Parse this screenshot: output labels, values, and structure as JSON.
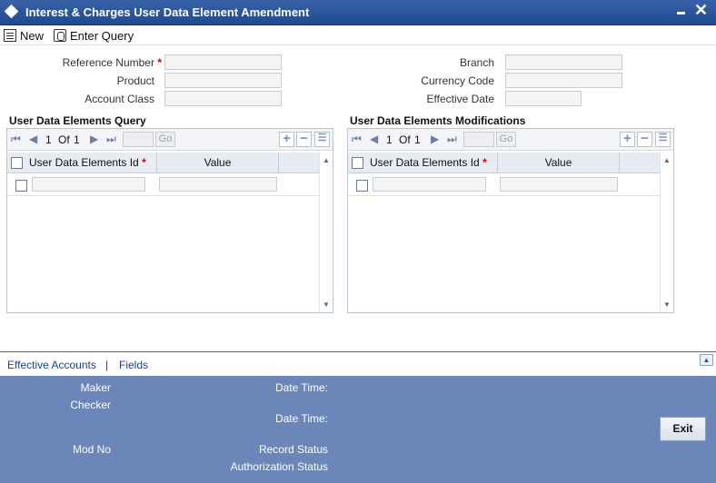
{
  "window": {
    "title": "Interest & Charges User Data Element Amendment"
  },
  "toolbar": {
    "new_label": "New",
    "enter_query_label": "Enter Query"
  },
  "form": {
    "reference_number": {
      "label": "Reference Number",
      "required": "*",
      "value": ""
    },
    "product": {
      "label": "Product",
      "value": ""
    },
    "account_class": {
      "label": "Account Class",
      "value": ""
    },
    "branch": {
      "label": "Branch",
      "value": ""
    },
    "currency_code": {
      "label": "Currency Code",
      "value": ""
    },
    "effective_date": {
      "label": "Effective Date",
      "value": ""
    }
  },
  "query_grid": {
    "title": "User Data Elements Query",
    "page_current": "1",
    "page_of": "Of",
    "page_total": "1",
    "go_label": "Go",
    "columns": {
      "id": "User Data Elements Id",
      "id_required": "*",
      "value": "Value"
    }
  },
  "mod_grid": {
    "title": "User Data Elements Modifications",
    "page_current": "1",
    "page_of": "Of",
    "page_total": "1",
    "go_label": "Go",
    "columns": {
      "id": "User Data Elements Id",
      "id_required": "*",
      "value": "Value"
    }
  },
  "links": {
    "effective_accounts": "Effective Accounts",
    "separator": "|",
    "fields": "Fields"
  },
  "footer": {
    "maker": "Maker",
    "checker": "Checker",
    "date_time_1": "Date Time:",
    "date_time_2": "Date Time:",
    "mod_no": "Mod No",
    "record_status": "Record Status",
    "authorization_status": "Authorization Status",
    "exit_label": "Exit"
  },
  "icons": {
    "titlebar": "diamond-icon",
    "new": "new-document-icon",
    "enter_query": "query-icon",
    "first": "first-page-icon",
    "prev": "previous-page-icon",
    "next": "next-page-icon",
    "last": "last-page-icon",
    "add": "plus-icon",
    "delete": "minus-icon",
    "single_view": "list-icon"
  },
  "colors": {
    "titlebar": "#2a5598",
    "footer": "#6b86b8",
    "link": "#1a3fa0",
    "required": "#cc0000"
  }
}
